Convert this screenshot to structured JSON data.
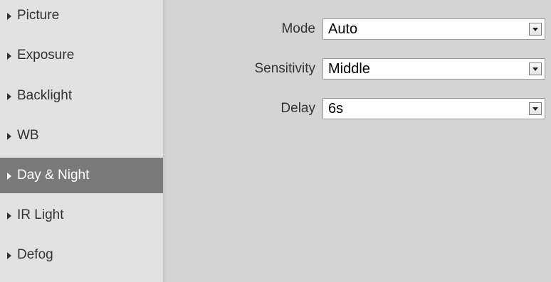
{
  "sidebar": {
    "items": [
      {
        "label": "Picture"
      },
      {
        "label": "Exposure"
      },
      {
        "label": "Backlight"
      },
      {
        "label": "WB"
      },
      {
        "label": "Day & Night",
        "active": true
      },
      {
        "label": "IR Light"
      },
      {
        "label": "Defog"
      }
    ]
  },
  "form": {
    "mode": {
      "label": "Mode",
      "value": "Auto"
    },
    "sensitivity": {
      "label": "Sensitivity",
      "value": "Middle"
    },
    "delay": {
      "label": "Delay",
      "value": "6s"
    }
  },
  "colors": {
    "sidebar_bg": "#e2e2e2",
    "content_bg": "#d4d4d4",
    "active_item_bg": "#7a7a7a",
    "active_item_text": "#ffffff",
    "text": "#333333"
  },
  "icons": {
    "nav_item": "caret-right-icon",
    "select": "chevron-down-icon"
  }
}
